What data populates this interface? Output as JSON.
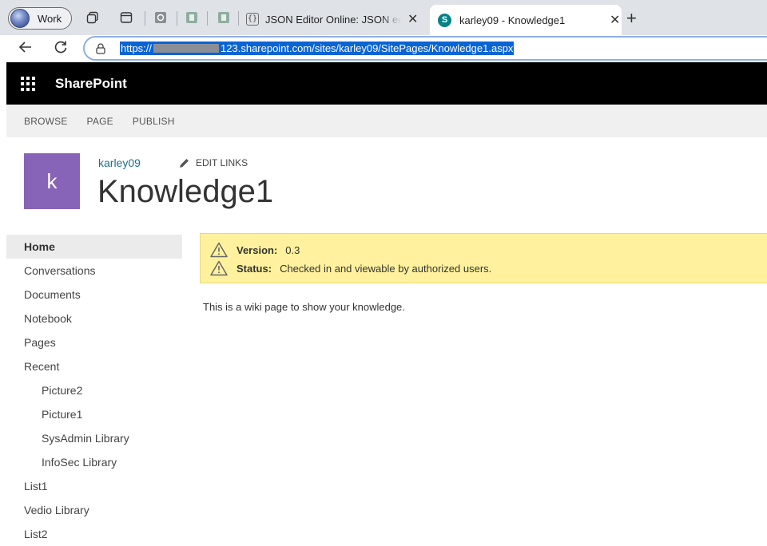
{
  "browser": {
    "profile_label": "Work",
    "tabs": [
      {
        "title": "JSON Editor Online: JSON editor, JSON formatter, query JSON",
        "favicon": "braces-icon"
      },
      {
        "title": "karley09 - Knowledge1",
        "favicon": "sharepoint-icon",
        "active": true
      }
    ],
    "url_prefix": "https://",
    "url_suffix": "123.sharepoint.com/sites/karley09/SitePages/Knowledge1.aspx"
  },
  "suite": {
    "brand": "SharePoint"
  },
  "ribbon": {
    "tabs": [
      "BROWSE",
      "PAGE",
      "PUBLISH"
    ]
  },
  "site": {
    "logo_letter": "k",
    "name": "karley09",
    "edit_links": "EDIT LINKS",
    "page_title": "Knowledge1"
  },
  "nav": {
    "items": [
      {
        "label": "Home",
        "level": 0,
        "selected": true
      },
      {
        "label": "Conversations",
        "level": 0
      },
      {
        "label": "Documents",
        "level": 0
      },
      {
        "label": "Notebook",
        "level": 0
      },
      {
        "label": "Pages",
        "level": 0
      },
      {
        "label": "Recent",
        "level": 0
      },
      {
        "label": "Picture2",
        "level": 1
      },
      {
        "label": "Picture1",
        "level": 1
      },
      {
        "label": "SysAdmin Library",
        "level": 1
      },
      {
        "label": "InfoSec Library",
        "level": 1
      },
      {
        "label": "List1",
        "level": 0
      },
      {
        "label": "Vedio Library",
        "level": 0
      },
      {
        "label": "List2",
        "level": 0
      }
    ]
  },
  "status": {
    "version_label": "Version:",
    "version_value": "0.3",
    "status_label": "Status:",
    "status_value": "Checked in and viewable by authorized users."
  },
  "content": {
    "body": "This is a wiki page to show your knowledge."
  },
  "colors": {
    "suite_bar": "#000000",
    "site_logo": "#8764b8",
    "status_banner": "#fff19d",
    "link": "#1f6f8b",
    "url_highlight": "#0a64d4"
  }
}
